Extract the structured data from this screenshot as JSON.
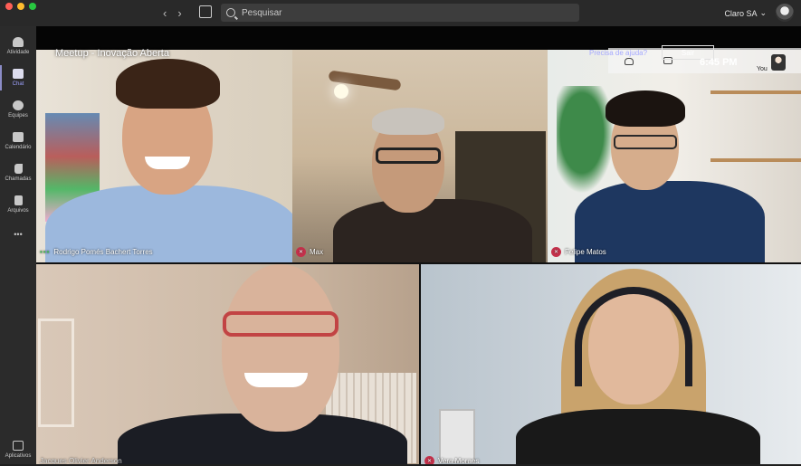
{
  "window": {
    "nav_back": "‹",
    "nav_forward": "›",
    "search_placeholder": "Pesquisar",
    "org_name": "Claro SA",
    "org_chevron": "⌄"
  },
  "rail": {
    "items": [
      {
        "label": "Atividade",
        "icon": "bell-icon"
      },
      {
        "label": "Chat",
        "icon": "chat-icon"
      },
      {
        "label": "Equipes",
        "icon": "teams-icon"
      },
      {
        "label": "Calendário",
        "icon": "calendar-icon"
      },
      {
        "label": "Chamadas",
        "icon": "phone-icon"
      },
      {
        "label": "Arquivos",
        "icon": "file-icon"
      }
    ],
    "more": "•••",
    "apps_label": "Aplicativos"
  },
  "meeting": {
    "title": "Meetup - Inovação Aberta",
    "controls": {
      "help_text": "Precisa de ajuda?",
      "leave_label": "Sair",
      "time": "6:45 PM",
      "self_label": "You"
    },
    "participants": [
      {
        "name": "Rodrigo Pomés Bachert Torres",
        "status": "speaking"
      },
      {
        "name": "Max",
        "status": "muted"
      },
      {
        "name": "Felipe Matos",
        "status": "muted"
      },
      {
        "name": "Jacques Olivier Anderson",
        "status": "none"
      },
      {
        "name": "Vera Moraes",
        "status": "muted"
      }
    ]
  },
  "colors": {
    "accent": "#8b8cc7",
    "mute": "#c4314b",
    "speaking": "#3fb950"
  }
}
